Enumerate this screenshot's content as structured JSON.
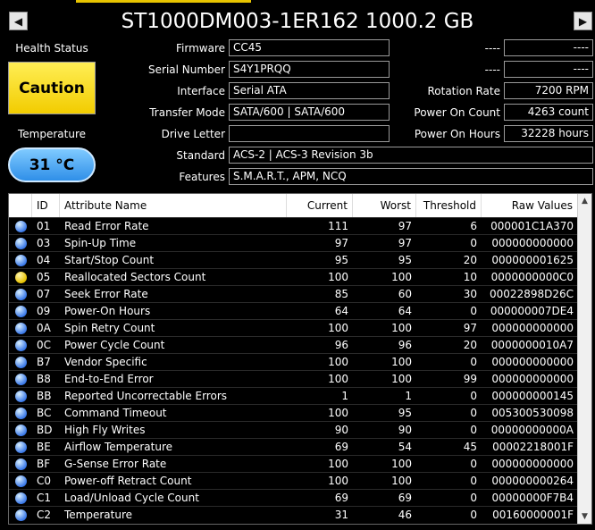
{
  "nav": {
    "prev_icon": "◀",
    "next_icon": "▶"
  },
  "drive_title": "ST1000DM003-1ER162 1000.2 GB",
  "left": {
    "health_label": "Health Status",
    "health_value": "Caution",
    "temperature_label": "Temperature",
    "temperature_value": "31 °C"
  },
  "info": {
    "firmware_label": "Firmware",
    "firmware": "CC45",
    "serial_label": "Serial Number",
    "serial": "S4Y1PRQQ",
    "interface_label": "Interface",
    "interface": "Serial ATA",
    "transfer_label": "Transfer Mode",
    "transfer": "SATA/600 | SATA/600",
    "drive_letter_label": "Drive Letter",
    "drive_letter": "",
    "standard_label": "Standard",
    "standard": "ACS-2 | ACS-3 Revision 3b",
    "features_label": "Features",
    "features": "S.M.A.R.T., APM, NCQ"
  },
  "right": {
    "blank1_label": "----",
    "blank1": "----",
    "blank2_label": "----",
    "blank2": "----",
    "rotation_label": "Rotation Rate",
    "rotation": "7200 RPM",
    "power_count_label": "Power On Count",
    "power_count": "4263 count",
    "power_hours_label": "Power On Hours",
    "power_hours": "32228 hours"
  },
  "table": {
    "headers": [
      "",
      "ID",
      "Attribute Name",
      "Current",
      "Worst",
      "Threshold",
      "Raw Values"
    ],
    "rows": [
      {
        "status": "good",
        "id": "01",
        "name": "Read Error Rate",
        "current": "111",
        "worst": "97",
        "threshold": "6",
        "raw": "000001C1A370"
      },
      {
        "status": "good",
        "id": "03",
        "name": "Spin-Up Time",
        "current": "97",
        "worst": "97",
        "threshold": "0",
        "raw": "000000000000"
      },
      {
        "status": "good",
        "id": "04",
        "name": "Start/Stop Count",
        "current": "95",
        "worst": "95",
        "threshold": "20",
        "raw": "000000001625"
      },
      {
        "status": "caution",
        "id": "05",
        "name": "Reallocated Sectors Count",
        "current": "100",
        "worst": "100",
        "threshold": "10",
        "raw": "0000000000C0"
      },
      {
        "status": "good",
        "id": "07",
        "name": "Seek Error Rate",
        "current": "85",
        "worst": "60",
        "threshold": "30",
        "raw": "00022898D26C"
      },
      {
        "status": "good",
        "id": "09",
        "name": "Power-On Hours",
        "current": "64",
        "worst": "64",
        "threshold": "0",
        "raw": "000000007DE4"
      },
      {
        "status": "good",
        "id": "0A",
        "name": "Spin Retry Count",
        "current": "100",
        "worst": "100",
        "threshold": "97",
        "raw": "000000000000"
      },
      {
        "status": "good",
        "id": "0C",
        "name": "Power Cycle Count",
        "current": "96",
        "worst": "96",
        "threshold": "20",
        "raw": "0000000010A7"
      },
      {
        "status": "good",
        "id": "B7",
        "name": "Vendor Specific",
        "current": "100",
        "worst": "100",
        "threshold": "0",
        "raw": "000000000000"
      },
      {
        "status": "good",
        "id": "B8",
        "name": "End-to-End Error",
        "current": "100",
        "worst": "100",
        "threshold": "99",
        "raw": "000000000000"
      },
      {
        "status": "good",
        "id": "BB",
        "name": "Reported Uncorrectable Errors",
        "current": "1",
        "worst": "1",
        "threshold": "0",
        "raw": "000000000145"
      },
      {
        "status": "good",
        "id": "BC",
        "name": "Command Timeout",
        "current": "100",
        "worst": "95",
        "threshold": "0",
        "raw": "005300530098"
      },
      {
        "status": "good",
        "id": "BD",
        "name": "High Fly Writes",
        "current": "90",
        "worst": "90",
        "threshold": "0",
        "raw": "00000000000A"
      },
      {
        "status": "good",
        "id": "BE",
        "name": "Airflow Temperature",
        "current": "69",
        "worst": "54",
        "threshold": "45",
        "raw": "00002218001F"
      },
      {
        "status": "good",
        "id": "BF",
        "name": "G-Sense Error Rate",
        "current": "100",
        "worst": "100",
        "threshold": "0",
        "raw": "000000000000"
      },
      {
        "status": "good",
        "id": "C0",
        "name": "Power-off Retract Count",
        "current": "100",
        "worst": "100",
        "threshold": "0",
        "raw": "000000000264"
      },
      {
        "status": "good",
        "id": "C1",
        "name": "Load/Unload Cycle Count",
        "current": "69",
        "worst": "69",
        "threshold": "0",
        "raw": "00000000F7B4"
      },
      {
        "status": "good",
        "id": "C2",
        "name": "Temperature",
        "current": "31",
        "worst": "46",
        "threshold": "0",
        "raw": "00160000001F"
      }
    ]
  },
  "scrollbar": {
    "up_icon": "▲",
    "down_icon": "▼"
  }
}
